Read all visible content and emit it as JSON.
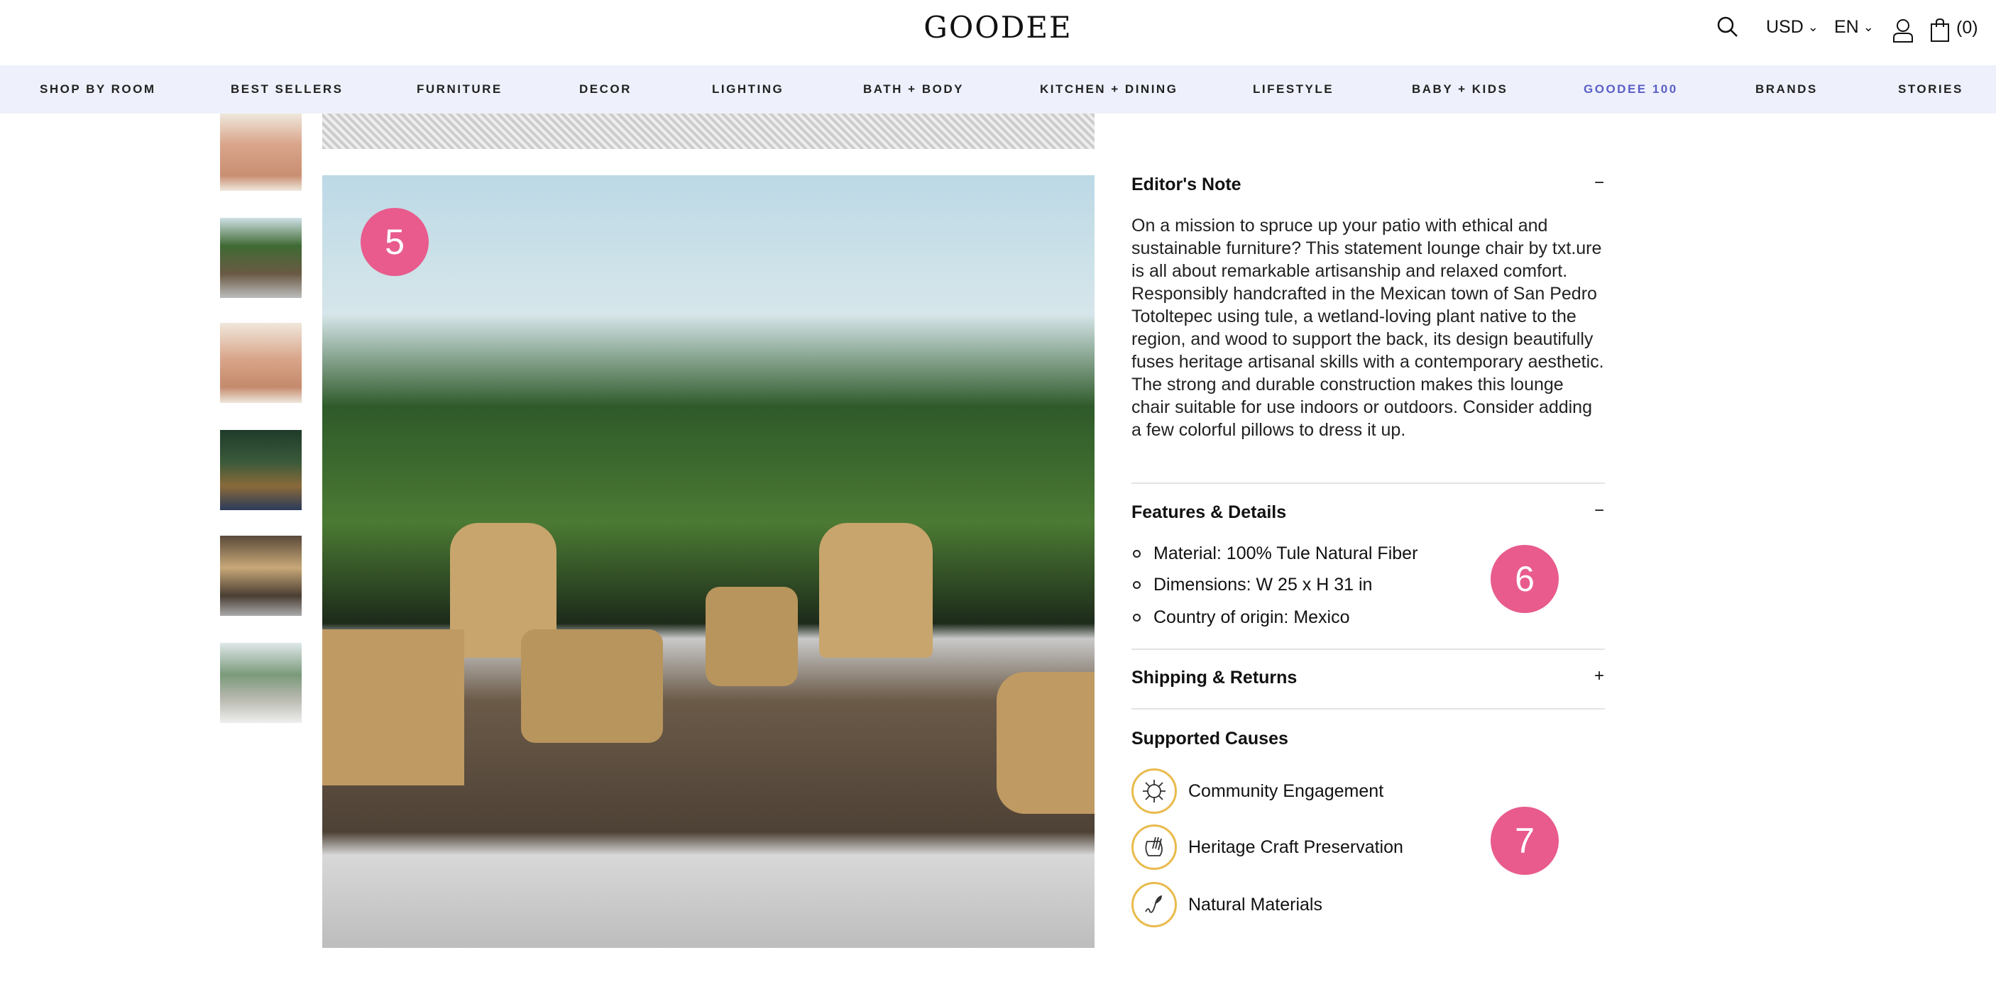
{
  "header": {
    "logo": "GOODEE",
    "currency": "USD",
    "language": "EN",
    "cart": "(0)"
  },
  "nav": [
    {
      "label": "SHOP BY ROOM"
    },
    {
      "label": "BEST SELLERS"
    },
    {
      "label": "FURNITURE"
    },
    {
      "label": "DECOR"
    },
    {
      "label": "LIGHTING"
    },
    {
      "label": "BATH + BODY"
    },
    {
      "label": "KITCHEN + DINING"
    },
    {
      "label": "LIFESTYLE"
    },
    {
      "label": "BABY + KIDS"
    },
    {
      "label": "GOODEE 100",
      "active": true
    },
    {
      "label": "BRANDS"
    },
    {
      "label": "STORIES"
    }
  ],
  "colors": {
    "nav_bg": "#eef1fb",
    "active_nav": "#5b5fc7",
    "badge": "#e85b8c",
    "cause_ring": "#e9bb4c"
  },
  "badges": {
    "b5": "5",
    "b6": "6",
    "b7": "7"
  },
  "editors_note": {
    "title": "Editor's Note",
    "toggle": "−",
    "text": "On a mission to spruce up your patio with ethical and sustainable furniture? This statement lounge chair by txt.ure is all about remarkable artisanship and relaxed comfort. Responsibly handcrafted in the Mexican town of San Pedro Totoltepec using tule, a wetland-loving plant native to the region, and wood to support the back, its design beautifully fuses heritage artisanal skills with a contemporary aesthetic. The strong and durable construction makes this lounge chair suitable for use indoors or outdoors. Consider adding a few colorful pillows to dress it up."
  },
  "features": {
    "title": "Features & Details",
    "toggle": "−",
    "items": [
      "Material: 100% Tule Natural Fiber",
      "Dimensions: W 25 x H 31 in",
      "Country of origin: Mexico"
    ]
  },
  "shipping": {
    "title": "Shipping & Returns",
    "toggle": "+"
  },
  "causes": {
    "title": "Supported Causes",
    "items": [
      {
        "label": "Community Engagement",
        "icon": "community-icon"
      },
      {
        "label": "Heritage Craft Preservation",
        "icon": "craft-icon"
      },
      {
        "label": "Natural Materials",
        "icon": "plant-icon"
      }
    ]
  }
}
